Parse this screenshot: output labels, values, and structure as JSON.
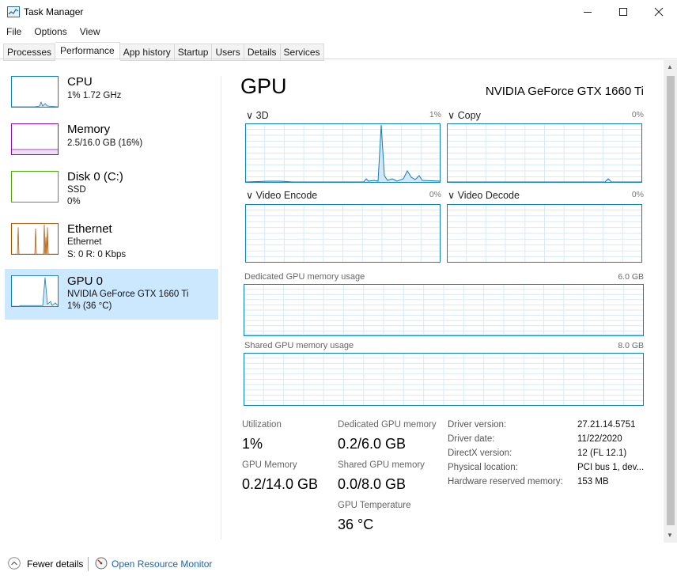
{
  "window": {
    "title": "Task Manager"
  },
  "menu": [
    "File",
    "Options",
    "View"
  ],
  "tabs": [
    {
      "label": "Processes"
    },
    {
      "label": "Performance"
    },
    {
      "label": "App history"
    },
    {
      "label": "Startup"
    },
    {
      "label": "Users"
    },
    {
      "label": "Details"
    },
    {
      "label": "Services"
    }
  ],
  "sidebar": {
    "items": [
      {
        "title": "CPU",
        "line1": "1% 1.72 GHz",
        "line2": "",
        "line3": "",
        "color": "#117dbb"
      },
      {
        "title": "Memory",
        "line1": "2.5/16.0 GB (16%)",
        "line2": "",
        "line3": "",
        "color": "#8b12ae"
      },
      {
        "title": "Disk 0 (C:)",
        "line1": "SSD",
        "line2": "0%",
        "line3": "",
        "color": "#4da60c"
      },
      {
        "title": "Ethernet",
        "line1": "Ethernet",
        "line2": "S: 0 R: 0 Kbps",
        "line3": "",
        "color": "#a74f01"
      },
      {
        "title": "GPU 0",
        "line1": "NVIDIA GeForce GTX 1660 Ti",
        "line2": "1% (36 °C)",
        "line3": "",
        "color": "#117dbb"
      }
    ]
  },
  "gpu": {
    "title": "GPU",
    "name": "NVIDIA GeForce GTX 1660 Ti",
    "engines": [
      {
        "label": "3D",
        "pct": "1%"
      },
      {
        "label": "Copy",
        "pct": "0%"
      },
      {
        "label": "Video Encode",
        "pct": "0%"
      },
      {
        "label": "Video Decode",
        "pct": "0%"
      }
    ],
    "dedicated": {
      "label": "Dedicated GPU memory usage",
      "max": "6.0 GB"
    },
    "shared": {
      "label": "Shared GPU memory usage",
      "max": "8.0 GB"
    },
    "stats": {
      "utilization_label": "Utilization",
      "utilization_value": "1%",
      "gpu_memory_label": "GPU Memory",
      "gpu_memory_value": "0.2/14.0 GB",
      "dedicated_label": "Dedicated GPU memory",
      "dedicated_value": "0.2/6.0 GB",
      "shared_label": "Shared GPU memory",
      "shared_value": "0.0/8.0 GB",
      "temp_label": "GPU Temperature",
      "temp_value": "36 °C"
    },
    "info": [
      {
        "label": "Driver version:",
        "value": "27.21.14.5751"
      },
      {
        "label": "Driver date:",
        "value": "11/22/2020"
      },
      {
        "label": "DirectX version:",
        "value": "12 (FL 12.1)"
      },
      {
        "label": "Physical location:",
        "value": "PCI bus 1, dev..."
      },
      {
        "label": "Hardware reserved memory:",
        "value": "153 MB"
      }
    ]
  },
  "footer": {
    "fewer_details": "Fewer details",
    "open_resource_monitor": "Open Resource Monitor"
  },
  "colors": {
    "gpu_line": "#117dbb",
    "gpu_grid": "#d9eaf7",
    "selected_bg": "#cce8ff",
    "link": "#1a66b3"
  }
}
